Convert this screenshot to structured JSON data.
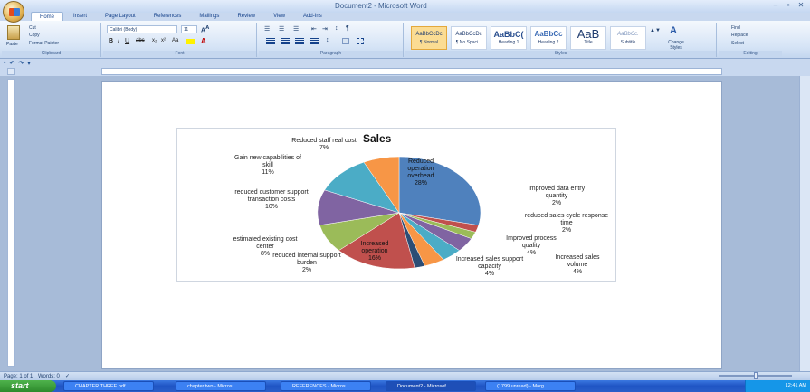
{
  "window": {
    "title": "Document2 - Microsoft Word"
  },
  "tabs": [
    "Home",
    "Insert",
    "Page Layout",
    "References",
    "Mailings",
    "Review",
    "View",
    "Add-Ins"
  ],
  "ribbon": {
    "clipboard": {
      "label": "Clipboard",
      "paste": "Paste",
      "cut": "Cut",
      "copy": "Copy",
      "format_painter": "Format Painter"
    },
    "font": {
      "label": "Font",
      "family": "Calibri (Body)",
      "size": "11"
    },
    "paragraph": {
      "label": "Paragraph"
    },
    "styles": {
      "label": "Styles",
      "items": [
        {
          "sample": "AaBbCcDc",
          "name": "¶ Normal",
          "selected": true
        },
        {
          "sample": "AaBbCcDc",
          "name": "¶ No Spaci...",
          "selected": false
        },
        {
          "sample": "AaBbC(",
          "name": "Heading 1",
          "selected": false
        },
        {
          "sample": "AaBbCc",
          "name": "Heading 2",
          "selected": false
        },
        {
          "sample": "AaB",
          "name": "Title",
          "selected": false
        },
        {
          "sample": "AaBbCc.",
          "name": "Subtitle",
          "selected": false
        }
      ],
      "change_styles": "Change Styles"
    },
    "editing": {
      "label": "Editing",
      "find": "Find",
      "replace": "Replace",
      "select": "Select"
    }
  },
  "statusbar": {
    "page": "Page: 1 of 1",
    "words": "Words: 0"
  },
  "chart_data": {
    "type": "pie",
    "title": "Sales",
    "series": [
      {
        "name": "Reduced operation overhead",
        "label": "Reduced operation overhead",
        "value": 28,
        "pct_label": "28%",
        "color": "#4f81bd"
      },
      {
        "name": "Improved data entry quantity",
        "label": "Improved data entry quantity",
        "value": 2,
        "pct_label": "2%",
        "color": "#c0504d"
      },
      {
        "name": "reduced sales cycle response time",
        "label": "reduced sales cycle response time",
        "value": 2,
        "pct_label": "2%",
        "color": "#9bbb59"
      },
      {
        "name": "Improved process quality",
        "label": "Improved process quality",
        "value": 4,
        "pct_label": "4%",
        "color": "#8064a2"
      },
      {
        "name": "Increased sales volume",
        "label": "Increased sales volume",
        "value": 4,
        "pct_label": "4%",
        "color": "#4bacc6"
      },
      {
        "name": "Increased sales support capacity",
        "label": "Increased sales support capacity",
        "value": 4,
        "pct_label": "4%",
        "color": "#f79646"
      },
      {
        "name": "reduced internal support burden",
        "label": "reduced internal support burden",
        "value": 2,
        "pct_label": "2%",
        "color": "#2c4d75"
      },
      {
        "name": "Increased operation",
        "label": "Increased operation",
        "value": 16,
        "pct_label": "16%",
        "color": "#c0504d"
      },
      {
        "name": "estimated existing cost center",
        "label": "estimated existing cost center",
        "value": 8,
        "pct_label": "8%",
        "color": "#9bbb59"
      },
      {
        "name": "reduced customer support transaction costs",
        "label": "reduced customer support transaction costs",
        "value": 10,
        "pct_label": "10%",
        "color": "#8064a2"
      },
      {
        "name": "Gain new capabilities of skill",
        "label": "Gain new capabilities of skill",
        "value": 11,
        "pct_label": "11%",
        "color": "#4bacc6"
      },
      {
        "name": "Reduced staff real cost",
        "label": "Reduced staff real cost",
        "value": 7,
        "pct_label": "7%",
        "color": "#f79646"
      }
    ]
  },
  "taskbar": {
    "start": "start",
    "tasks": [
      "CHAPTER THREE.pdf ...",
      "chapter two - Micros...",
      "REFERENCES - Micros...",
      "Document2 - Microsof...",
      "(1799 unread) - Marg..."
    ],
    "clock": "12:41 AM"
  }
}
